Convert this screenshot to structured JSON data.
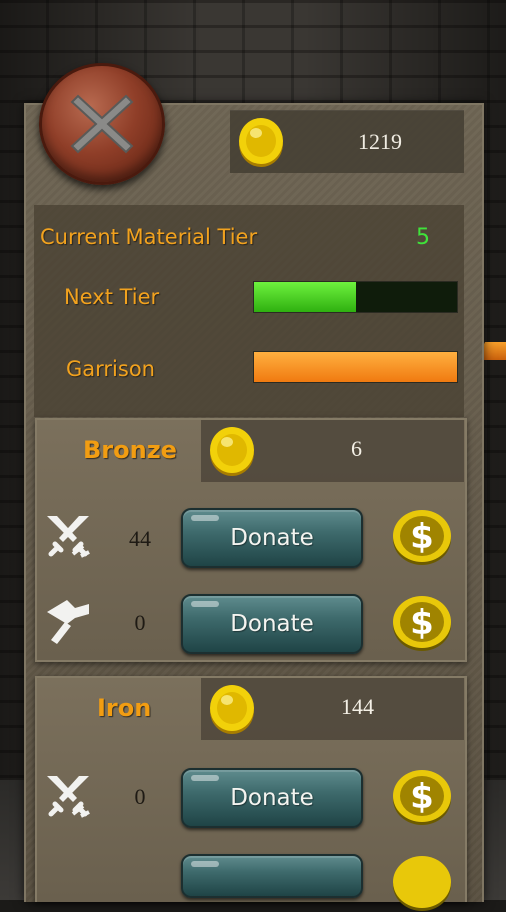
{
  "coins": {
    "total": "1219",
    "icon": "gold-coin-icon"
  },
  "tier": {
    "current_label": "Current Material Tier",
    "current_value": "5",
    "next_label": "Next Tier",
    "next_progress": 0.5,
    "garrison_label": "Garrison",
    "garrison_progress": 1.0
  },
  "materials": [
    {
      "name": "Bronze",
      "coin_value": "6",
      "weapons_count": "44",
      "tools_count": "0",
      "donate_label": "Donate"
    },
    {
      "name": "Iron",
      "coin_value": "144",
      "weapons_count": "0",
      "donate_label": "Donate"
    }
  ],
  "colors": {
    "accent_orange": "#f29d12",
    "tier_green": "#3fe33a",
    "progress_green": "#45d11f",
    "garrison_orange": "#f6952a"
  }
}
